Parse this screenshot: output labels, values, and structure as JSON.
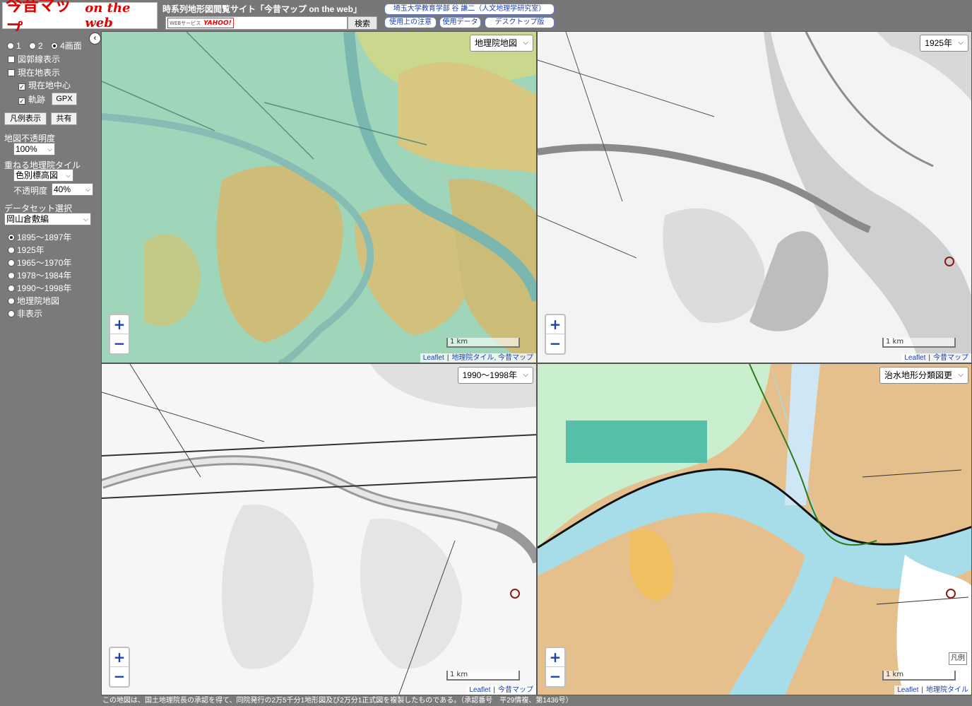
{
  "header": {
    "logo_main": "今昔マップ",
    "logo_sub": "on the web",
    "site_title": "時系列地形図閲覧サイト「今昔マップ on the web」",
    "search": {
      "badge_web": "WEBサービス",
      "badge_yahoo": "YAHOO!",
      "placeholder": "",
      "value": "",
      "button_label": "検索"
    },
    "buttons": {
      "author": "埼玉大学教育学部 谷 謙二（人文地理学研究室）",
      "notes": "使用上の注意",
      "data": "使用データ",
      "desktop": "デスクトップ版"
    }
  },
  "sidebar": {
    "collapse_icon": "‹",
    "screen_options": [
      {
        "label": "1",
        "selected": false
      },
      {
        "label": "2",
        "selected": false
      },
      {
        "label": "4画面",
        "selected": true
      }
    ],
    "checks": {
      "grid": {
        "label": "図郭線表示",
        "checked": false
      },
      "current_location": {
        "label": "現在地表示",
        "checked": false
      },
      "center_current": {
        "label": "現在地中心",
        "checked": true
      },
      "track": {
        "label": "軌跡",
        "checked": true
      }
    },
    "gpx_button": "GPX",
    "legend_button": "凡例表示",
    "share_button": "共有",
    "map_opacity_label": "地図不透明度",
    "map_opacity_value": "100%",
    "overlay_label": "重ねる地理院タイル",
    "overlay_value": "色別標高図",
    "overlay_opacity_label": "不透明度",
    "overlay_opacity_value": "40%",
    "dataset_label": "データセット選択",
    "dataset_value": "岡山倉敷編",
    "eras": [
      {
        "label": "1895～1897年",
        "selected": true
      },
      {
        "label": "1925年",
        "selected": false
      },
      {
        "label": "1965～1970年",
        "selected": false
      },
      {
        "label": "1978～1984年",
        "selected": false
      },
      {
        "label": "1990～1998年",
        "selected": false
      },
      {
        "label": "地理院地図",
        "selected": false
      },
      {
        "label": "非表示",
        "selected": false
      }
    ]
  },
  "maps": [
    {
      "select": "地理院地図",
      "scale": "1 km",
      "attrib": [
        "Leaflet",
        "地理院タイル",
        "今昔マップ"
      ]
    },
    {
      "select": "1925年",
      "scale": "1 km",
      "attrib": [
        "Leaflet",
        "今昔マップ"
      ]
    },
    {
      "select": "1990～1998年",
      "scale": "1 km",
      "attrib": [
        "Leaflet",
        "今昔マップ"
      ]
    },
    {
      "select": "治水地形分類図更",
      "scale": "1 km",
      "attrib": [
        "Leaflet",
        "地理院タイル"
      ],
      "legend_label": "凡例"
    }
  ],
  "zoom": {
    "in": "+",
    "out": "−"
  },
  "footer_note": "この地図は、国土地理院長の承認を得て、同院発行の2万5千分1地形図及び2万分1正式図を複製したものである。（承認番号　平29情複、第1436号）",
  "colors": {
    "accent_link": "#1a3fb5",
    "logo_red": "#e00000",
    "marker": "#8a1c1c"
  }
}
